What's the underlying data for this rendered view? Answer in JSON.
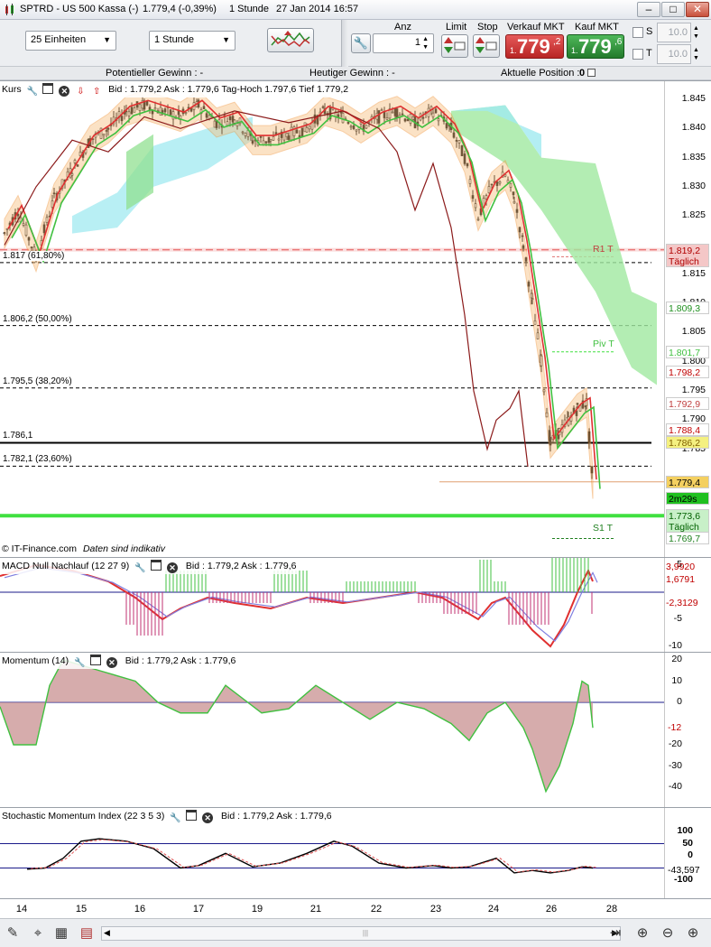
{
  "window": {
    "symbol": "SPTRD - US 500 Kassa (-)",
    "last": "1.779,4 (-0,39%)",
    "interval": "1 Stunde",
    "datetime": "27 Jan 2014 16:57",
    "min_glyph": "–",
    "max_glyph": "□",
    "close_glyph": "✕"
  },
  "toolbar": {
    "units_value": "25 Einheiten",
    "interval_value": "1 Stunde",
    "anz_label": "Anz",
    "anz_value": "1",
    "limit_label": "Limit",
    "stop_label": "Stop",
    "sell_label": "Verkauf MKT",
    "buy_label": "Kauf MKT",
    "sell_prefix": "1.",
    "sell_main": "779",
    "sell_suffix": ",2",
    "buy_prefix": "1.",
    "buy_main": "779",
    "buy_suffix": ",6",
    "s_label": "S",
    "t_label": "T",
    "s_value": "10.0",
    "t_value": "10.0",
    "sell_color": "#d63a3a",
    "buy_color": "#2f9a3c"
  },
  "info": {
    "potential": "Potentieller Gewinn : -",
    "today": "Heutiger Gewinn : -",
    "position_label": "Aktuelle Position :",
    "position_value": "0"
  },
  "price_panel": {
    "title": "Kurs",
    "bidask": "Bid : 1.779,2  Ask : 1.779,6  Tag-Hoch 1.797,6  Tief 1.779,2",
    "source": "© IT-Finance.com",
    "source_note": "Daten sind indikativ",
    "axis_ticks": [
      "1.845",
      "1.840",
      "1.835",
      "1.830",
      "1.825",
      "1.815",
      "1.810",
      "1.805",
      "1.800",
      "1.795",
      "1.790",
      "1.785"
    ],
    "levels": [
      {
        "text": "1.817 (61,80%)",
        "price": 1817
      },
      {
        "text": "1.806,2 (50,00%)",
        "price": 1806.2
      },
      {
        "text": "1.795,5 (38,20%)",
        "price": 1795.5
      },
      {
        "text": "1.786,1",
        "price": 1786.1
      },
      {
        "text": "1.782,1 (23,60%)",
        "price": 1782.1
      }
    ],
    "pivot_labels": {
      "r1": "R1 T",
      "piv": "Piv T",
      "s1": "S1 T"
    },
    "price_labels": [
      {
        "text": "1.819,2",
        "sub": "Täglich",
        "price": 1819.2,
        "bg": "#f4c7c7",
        "color": "#b00000"
      },
      {
        "text": "1.809,3",
        "price": 1809.3,
        "bg": "#ffffff",
        "color": "#209020"
      },
      {
        "text": "1.801,7",
        "price": 1801.7,
        "bg": "#ffffff",
        "color": "#40c040"
      },
      {
        "text": "1.798,2",
        "price": 1798.2,
        "bg": "#ffffff",
        "color": "#c00000"
      },
      {
        "text": "1.792,9",
        "price": 1792.9,
        "bg": "#ffffff",
        "color": "#c04040"
      },
      {
        "text": "1.788,4",
        "price": 1788.4,
        "bg": "#ffffff",
        "color": "#c00000"
      },
      {
        "text": "1.786,2",
        "price": 1786.2,
        "bg": "#f4f080",
        "color": "#806000"
      },
      {
        "text": "1.779,4",
        "price": 1779.4,
        "bg": "#f4d060",
        "color": "#000000"
      },
      {
        "text": "2m29s",
        "price": 1776.6,
        "bg": "#20c020",
        "color": "#000000"
      },
      {
        "text": "1.773,6",
        "sub": "Täglich",
        "price": 1773.6,
        "bg": "#c8f0c8",
        "color": "#006000"
      },
      {
        "text": "1.769,7",
        "price": 1769.7,
        "bg": "#ffffff",
        "color": "#208020"
      }
    ]
  },
  "macd_panel": {
    "title": "MACD Null Nachlauf (12 27 9)",
    "bidask": "Bid : 1.779,2  Ask : 1.779,6",
    "axis_ticks": [
      "5",
      "-5",
      "-10"
    ],
    "value_labels": [
      {
        "text": "3,9920",
        "color": "#c00000"
      },
      {
        "text": "1,6791",
        "color": "#c00000"
      },
      {
        "text": "-2,3129",
        "color": "#c00000"
      }
    ]
  },
  "momentum_panel": {
    "title": "Momentum (14)",
    "bidask": "Bid : 1.779,2  Ask : 1.779,6",
    "axis_ticks": [
      "20",
      "10",
      "0",
      "-20",
      "-30",
      "-40"
    ],
    "value_label": "-12"
  },
  "smi_panel": {
    "title": "Stochastic Momentum Index (22 3 5 3)",
    "bidask": "Bid : 1.779,2  Ask : 1.779,6",
    "axis_ticks": [
      "100",
      "50",
      "0",
      "-100"
    ],
    "value_label": "-43,597"
  },
  "x_axis": [
    "14",
    "15",
    "16",
    "17",
    "19",
    "21",
    "22",
    "23",
    "24",
    "26",
    "28"
  ],
  "bottombar": {
    "scroll_center_glyph": "|||",
    "left_arrow": "◀",
    "right_arrow": "▶"
  }
}
